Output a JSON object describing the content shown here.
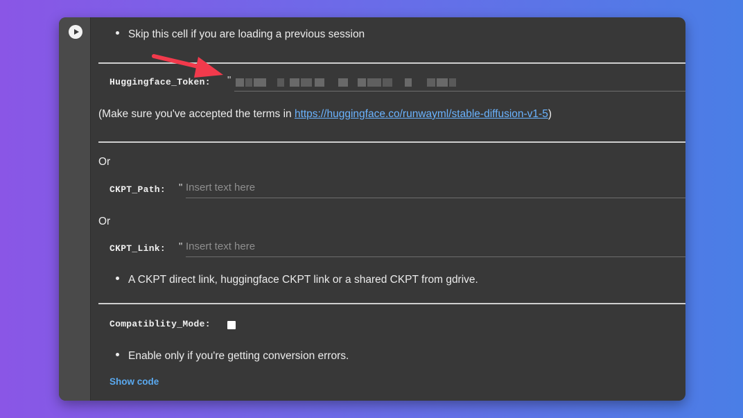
{
  "cell": {
    "bullets_top": [
      "Skip this cell if you are loading a previous session"
    ],
    "token": {
      "label": "Huggingface_Token:",
      "quote": "\""
    },
    "terms": {
      "prefix": "(Make sure you've accepted the terms in ",
      "link": "https://huggingface.co/runwayml/stable-diffusion-v1-5",
      "suffix": ")"
    },
    "or_1": "Or",
    "ckpt_path": {
      "label": "CKPT_Path:",
      "quote": "\"",
      "placeholder": "Insert text here"
    },
    "or_2": "Or",
    "ckpt_link": {
      "label": "CKPT_Link:",
      "quote": "\"",
      "placeholder": "Insert text here"
    },
    "ckpt_link_note": "A CKPT direct link, huggingface CKPT link or a shared CKPT from gdrive.",
    "compat": {
      "label": "Compatiblity_Mode:",
      "checked": false
    },
    "compat_note": "Enable only if you're getting conversion errors.",
    "show_code": "Show code"
  },
  "colors": {
    "background_start": "#8a56e6",
    "background_end": "#4a7ee6",
    "cell_bg": "#383838",
    "link": "#6ab3ff",
    "arrow": "#f23a4c"
  },
  "icons": {
    "run": "play-icon",
    "annotation": "red-arrow-icon"
  }
}
